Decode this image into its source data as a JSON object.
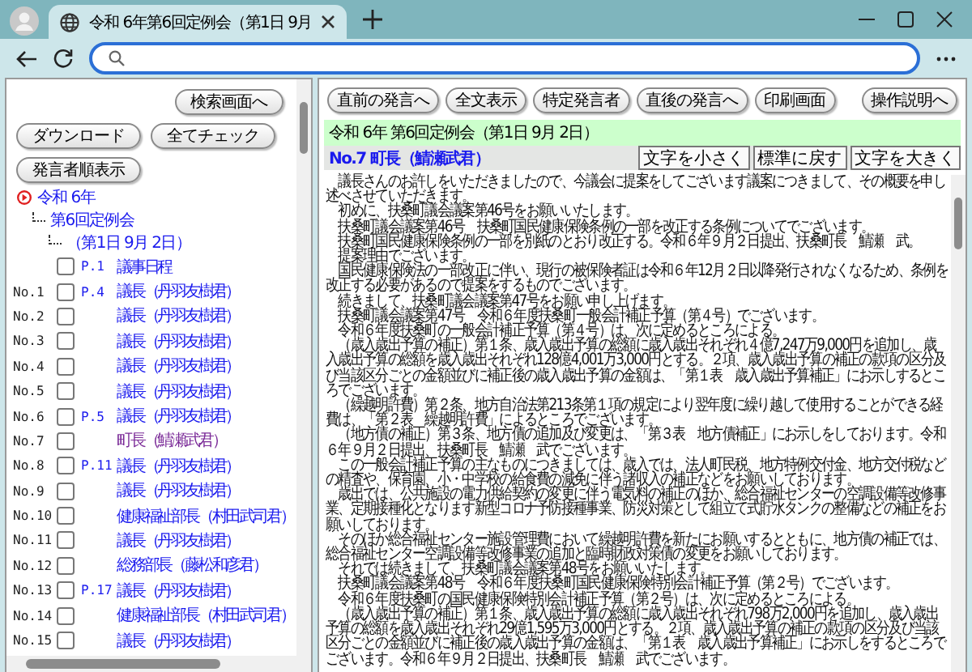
{
  "browser": {
    "tab_title": "令和 6年第6回定例会（第1日 9月"
  },
  "sidebar": {
    "buttons": [
      [
        "検索画面へ"
      ],
      [
        "ダウンロード",
        "全てチェック"
      ],
      [
        "発言者順表示"
      ]
    ],
    "tree": [
      {
        "kind": "root",
        "label": "令和 6年",
        "children": [
          {
            "kind": "folder",
            "label": "第6回定例会",
            "children": [
              {
                "kind": "folder",
                "label": "（第1日 9月 2日）",
                "children": [
                  {
                    "kind": "speech",
                    "checked": false,
                    "page": "P.1",
                    "speaker": "議事日程",
                    "selected": false
                  },
                  {
                    "kind": "speech",
                    "number": "No.1",
                    "checked": false,
                    "page": "P.4",
                    "speaker": "議長（丹羽友樹君）",
                    "selected": false
                  },
                  {
                    "kind": "speech",
                    "number": "No.2",
                    "checked": false,
                    "speaker": "議長（丹羽友樹君）",
                    "selected": false
                  },
                  {
                    "kind": "speech",
                    "number": "No.3",
                    "checked": false,
                    "speaker": "議長（丹羽友樹君）",
                    "selected": false
                  },
                  {
                    "kind": "speech",
                    "number": "No.4",
                    "checked": false,
                    "speaker": "議長（丹羽友樹君）",
                    "selected": false
                  },
                  {
                    "kind": "speech",
                    "number": "No.5",
                    "checked": false,
                    "speaker": "議長（丹羽友樹君）",
                    "selected": false
                  },
                  {
                    "kind": "speech",
                    "number": "No.6",
                    "checked": false,
                    "page": "P.5",
                    "speaker": "議長（丹羽友樹君）",
                    "selected": false
                  },
                  {
                    "kind": "speech",
                    "number": "No.7",
                    "checked": false,
                    "speaker": "町長（鯖瀬武君）",
                    "selected": true
                  },
                  {
                    "kind": "speech",
                    "number": "No.8",
                    "checked": false,
                    "page": "P.11",
                    "speaker": "議長（丹羽友樹君）",
                    "selected": false
                  },
                  {
                    "kind": "speech",
                    "number": "No.9",
                    "checked": false,
                    "speaker": "議長（丹羽友樹君）",
                    "selected": false
                  },
                  {
                    "kind": "speech",
                    "number": "No.10",
                    "checked": false,
                    "speaker": "健康福祉部長（村田武司君）",
                    "selected": false
                  },
                  {
                    "kind": "speech",
                    "number": "No.11",
                    "checked": false,
                    "speaker": "議長（丹羽友樹君）",
                    "selected": false
                  },
                  {
                    "kind": "speech",
                    "number": "No.12",
                    "checked": false,
                    "speaker": "総務部長（藤松和彦君）",
                    "selected": false
                  },
                  {
                    "kind": "speech",
                    "number": "No.13",
                    "checked": false,
                    "page": "P.17",
                    "speaker": "議長（丹羽友樹君）",
                    "selected": false
                  },
                  {
                    "kind": "speech",
                    "number": "No.14",
                    "checked": false,
                    "speaker": "健康福祉部長（村田武司君）",
                    "selected": false
                  },
                  {
                    "kind": "speech",
                    "number": "No.15",
                    "checked": false,
                    "speaker": "議長（丹羽友樹君）",
                    "selected": false
                  }
                ]
              }
            ]
          }
        ]
      }
    ]
  },
  "main": {
    "nav_buttons": [
      [
        "直前の発言へ",
        "全文表示",
        "特定発言者"
      ],
      [
        "直後の発言へ",
        "印刷画面"
      ]
    ],
    "help_button": "操作説明へ",
    "meeting_title": "令和 6年 第6回定例会（第1日 9月 2日）",
    "speaker_heading": "No.7 町長（鯖瀬武君）",
    "font_buttons": [
      "文字を小さく",
      "標準に戻す",
      "文字を大きく"
    ],
    "paragraphs": [
      "　議長さんのお許しをいただきましたので、今議会に提案をしてございます議案につきまして、その概要を申し述べさせていただきます。",
      "　初めに、扶桑町議会議案第46号をお願いいたします。",
      "　扶桑町議会議案第46号　扶桑町国民健康保険条例の一部を改正する条例についてでございます。",
      "　扶桑町国民健康保険条例の一部を別紙のとおり改正する。令和６年９月２日提出、扶桑町長　鯖瀬　武。",
      "　提案理由でございます。",
      "　国民健康保険法の一部改正に伴い、現行の被保険者証は令和６年12月２日以降発行されなくなるため、条例を改正する必要があるので提案をするものでございます。",
      "　続きまして、扶桑町議会議案第47号をお願い申し上げます。",
      "　扶桑町議会議案第47号　令和６年度扶桑町一般会計補正予算（第４号）でございます。",
      "　令和６年度扶桑町の一般会計補正予算（第４号）は、次に定めるところによる。",
      "　（歳入歳出予算の補正）第１条、歳入歳出予算の総額に歳入歳出それぞれ４億7,247万9,000円を追加し、歳入歳出予算の総額を歳入歳出それぞれ128億4,001万3,000円とする。２項、歳入歳出予算の補正の款項の区分及び当該区分ごとの金額並びに補正後の歳入歳出予算の金額は、「第１表　歳入歳出予算補正」にお示しするところでございます。",
      "　（繰越明許費）第２条、地方自治法第213条第１項の規定により翌年度に繰り越して使用することができる経費は、「第２表　繰越明許費」によるところでございます。",
      "　（地方債の補正）第３条、地方債の追加及び変更は、「第３表　地方債補正」にお示しをしております。令和６年９月２日提出、扶桑町長　鯖瀬　武でございます。",
      "　この一般会計補正予算の主なものにつきましては、歳入では、法人町民税、地方特例交付金、地方交付税などの精査や、保育園、小・中学校の給食費の減免に伴う諸収入の補正などをお願いしております。",
      "　歳出では、公共施設の電力供給契約の変更に伴う電気料の補正のほか、総合福祉センターの空調設備等改修事業、定期接種化となります新型コロナ予防接種事業、防災対策として組立て式貯水タンクの整備などの補正をお願いしております。",
      "　そのほか総合福祉センター施設管理費において繰越明許費を新たにお願いするとともに、地方債の補正では、総合福祉センター空調設備等改修事業の追加と臨時財政対策債の変更をお願いしております。",
      "　それでは続きまして、扶桑町議会議案第48号をお願いいたします。",
      "　扶桑町議会議案第48号　令和６年度扶桑町国民健康保険特別会計補正予算（第２号）でございます。",
      "　令和６年度扶桑町の国民健康保険特別会計補正予算（第２号）は、次に定めるところによる。",
      "　（歳入歳出予算の補正）第１条、歳入歳出予算の総額に歳入歳出それぞれ798万2,000円を追加し、歳入歳出予算の総額を歳入歳出それぞれ29億1,595万3,000円とする。２項、歳入歳出予算の補正の款項の区分及び当該区分ごとの金額並びに補正後の歳入歳出予算の金額は、「第１表　歳入歳出予算補正」にお示しをするところでございます。令和６年９月２日提出、扶桑町長　鯖瀬　武でございます。"
    ]
  }
}
